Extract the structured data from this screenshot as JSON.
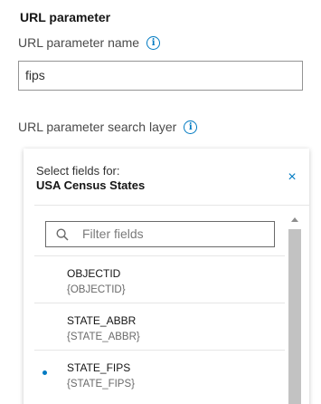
{
  "section": {
    "title": "URL parameter"
  },
  "param_name": {
    "label": "URL parameter name",
    "value": "fips"
  },
  "search_layer": {
    "label": "URL parameter search layer"
  },
  "field_panel": {
    "heading": "Select fields for:",
    "layer_name": "USA Census States",
    "close_glyph": "×",
    "filter_placeholder": "Filter fields",
    "fields": [
      {
        "name": "OBJECTID",
        "token": "{OBJECTID}",
        "selected": false
      },
      {
        "name": "STATE_ABBR",
        "token": "{STATE_ABBR}",
        "selected": false
      },
      {
        "name": "STATE_FIPS",
        "token": "{STATE_FIPS}",
        "selected": true
      }
    ]
  },
  "icons": {
    "info": "info-icon",
    "search": "search-icon",
    "close": "close-icon"
  },
  "colors": {
    "accent": "#007ac2",
    "border": "#949494",
    "text": "#323232"
  }
}
